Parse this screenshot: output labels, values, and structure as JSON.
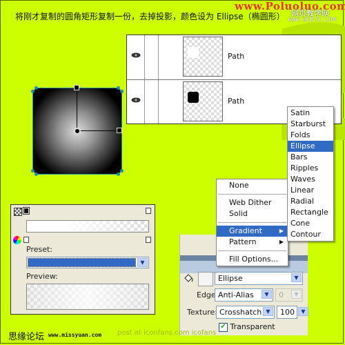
{
  "caption": "将刚才复制的圆角矩形复制一份，去掉投影，颜色设为 Ellipse（椭圆形）",
  "watermarks": {
    "site1": "www.Poluoluo.com",
    "site2_cn": "网页教学网",
    "site2_url": "WWW.WEBJX.COM",
    "forum_cn": "思缘论坛",
    "forum_url": "www.missyuan.com",
    "faint": "post at iconfans.com  icofans"
  },
  "layers": [
    {
      "name": "Path",
      "visible": true,
      "thumb_color": "#ffffff"
    },
    {
      "name": "Path",
      "visible": true,
      "thumb_color": "#000000"
    }
  ],
  "gradient_editor": {
    "preset_label": "Preset:",
    "preset_value": "",
    "preview_label": "Preview:"
  },
  "fill_menu": {
    "items": [
      {
        "label": "None"
      },
      {
        "sep": true
      },
      {
        "label": "Web Dither"
      },
      {
        "label": "Solid"
      },
      {
        "sep": true
      },
      {
        "label": "Gradient",
        "submenu": true,
        "highlighted": true
      },
      {
        "label": "Pattern",
        "submenu": true
      },
      {
        "sep": true
      },
      {
        "label": "Fill Options..."
      }
    ]
  },
  "gradient_submenu": {
    "items": [
      "Satin",
      "Starburst",
      "Folds",
      "Ellipse",
      "Bars",
      "Ripples",
      "Waves",
      "Linear",
      "Radial",
      "Rectangle",
      "Cone",
      "Contour"
    ],
    "selected": "Ellipse"
  },
  "properties": {
    "fill_type": "Ellipse",
    "edge_label": "Edge:",
    "edge_value": "Anti-Alias",
    "feather_value": "0",
    "texture_label": "Texture:",
    "texture_value": "Crosshatch :",
    "texture_amount": "100",
    "transparent_label": "Transparent",
    "transparent_checked": true
  },
  "colors": {
    "background": "#ccff00",
    "highlight": "#316ac5",
    "handle": "#1a8fb0"
  }
}
